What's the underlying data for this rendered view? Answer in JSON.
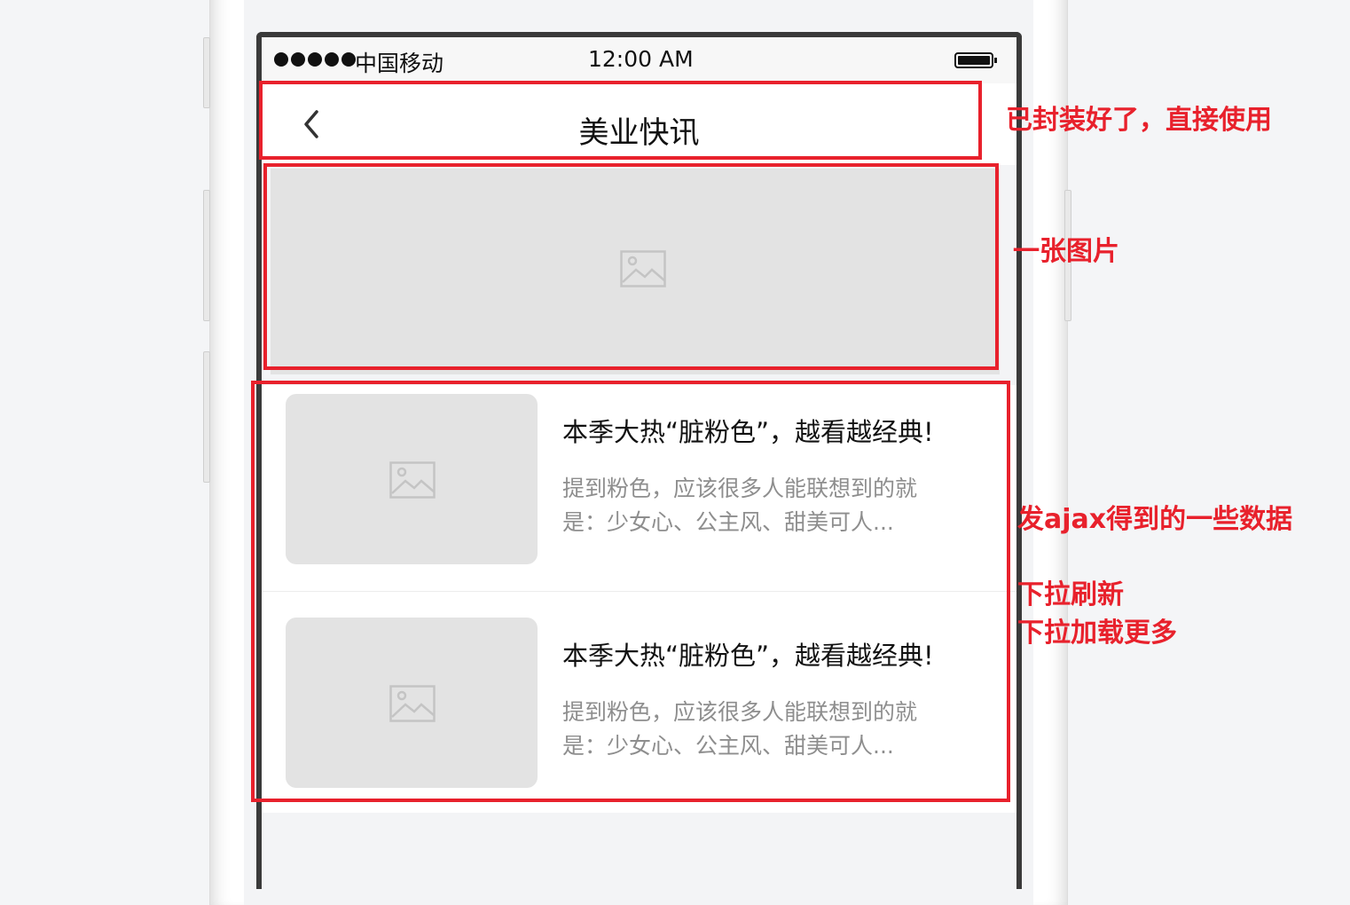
{
  "status_bar": {
    "carrier": "中国移动",
    "time": "12:00 AM"
  },
  "nav": {
    "title": "美业快讯",
    "back_icon": "chevron-left-icon"
  },
  "banner": {
    "icon": "image-placeholder-icon"
  },
  "list": {
    "items": [
      {
        "title": "本季大热“脏粉色”，越看越经典!",
        "desc_line1": "提到粉色，应该很多人能联想到的就",
        "desc_line2": "是：少女心、公主风、甜美可人..."
      },
      {
        "title": "本季大热“脏粉色”，越看越经典!",
        "desc_line1": "提到粉色，应该很多人能联想到的就",
        "desc_line2": "是：少女心、公主风、甜美可人..."
      }
    ]
  },
  "annotations": {
    "header_note": "已封装好了，直接使用",
    "banner_note": "一张图片",
    "list_note": "发ajax得到的一些数据",
    "refresh_note": "下拉刷新",
    "load_more_note": "下拉加载更多"
  },
  "colors": {
    "annotation": "#e8212c",
    "placeholder": "#e3e3e3",
    "desc_text": "#8e8e8e"
  }
}
